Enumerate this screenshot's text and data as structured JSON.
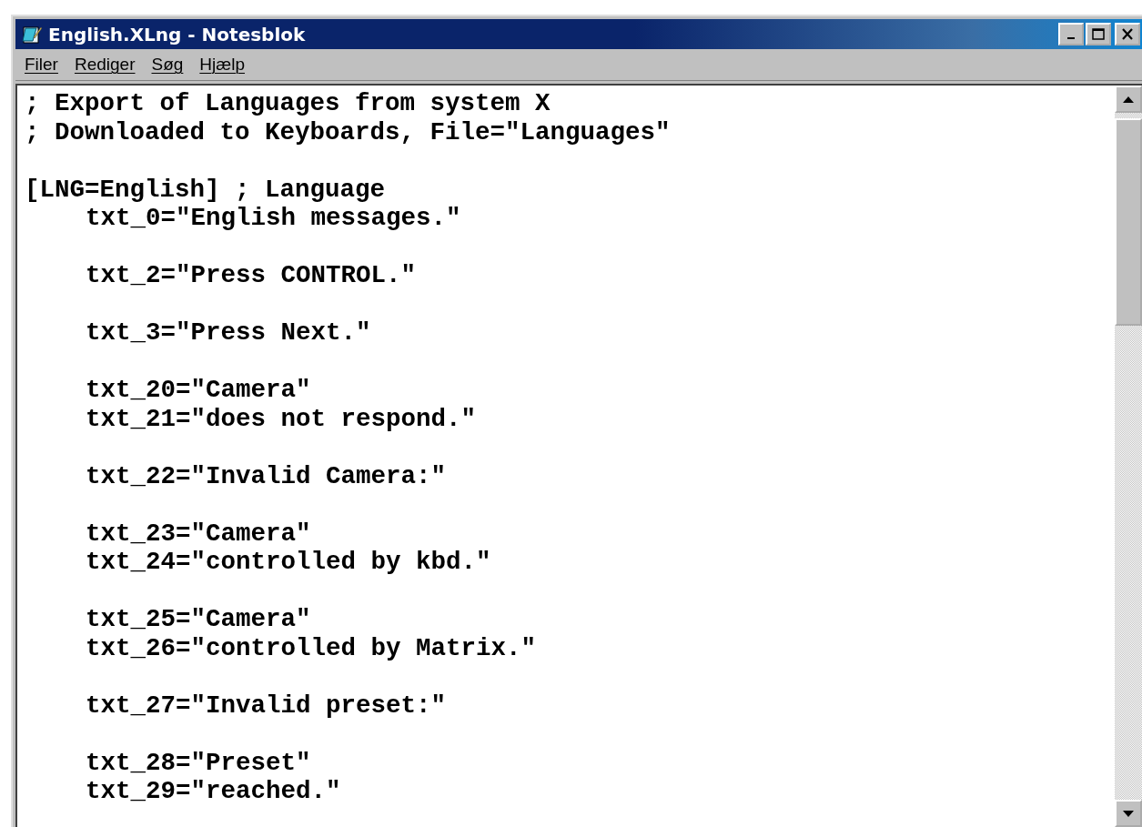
{
  "window": {
    "title": "English.XLng - Notesblok"
  },
  "menu": [
    {
      "label": "Filer"
    },
    {
      "label": "Rediger"
    },
    {
      "label": "Søg"
    },
    {
      "label": "Hjælp"
    }
  ],
  "editor": {
    "blocks": [
      [
        {
          "kind": "comment",
          "text": "; Export of Languages from system X"
        },
        {
          "kind": "comment",
          "text": "; Downloaded to Keyboards, File=\"Languages\""
        }
      ],
      [
        {
          "kind": "section",
          "text": "[LNG=English] ; Language"
        },
        {
          "kind": "entry",
          "text": "txt_0=\"English messages.\""
        }
      ],
      [
        {
          "kind": "entry",
          "text": "txt_2=\"Press CONTROL.\""
        }
      ],
      [
        {
          "kind": "entry",
          "text": "txt_3=\"Press Next.\""
        }
      ],
      [
        {
          "kind": "entry",
          "text": "txt_20=\"Camera\""
        },
        {
          "kind": "entry",
          "text": "txt_21=\"does not respond.\""
        }
      ],
      [
        {
          "kind": "entry",
          "text": "txt_22=\"Invalid Camera:\""
        }
      ],
      [
        {
          "kind": "entry",
          "text": "txt_23=\"Camera\""
        },
        {
          "kind": "entry",
          "text": "txt_24=\"controlled by kbd.\""
        }
      ],
      [
        {
          "kind": "entry",
          "text": "txt_25=\"Camera\""
        },
        {
          "kind": "entry",
          "text": "txt_26=\"controlled by Matrix.\""
        }
      ],
      [
        {
          "kind": "entry",
          "text": "txt_27=\"Invalid preset:\""
        }
      ],
      [
        {
          "kind": "entry",
          "text": "txt_28=\"Preset\""
        },
        {
          "kind": "entry",
          "text": "txt_29=\"reached.\""
        }
      ]
    ]
  }
}
